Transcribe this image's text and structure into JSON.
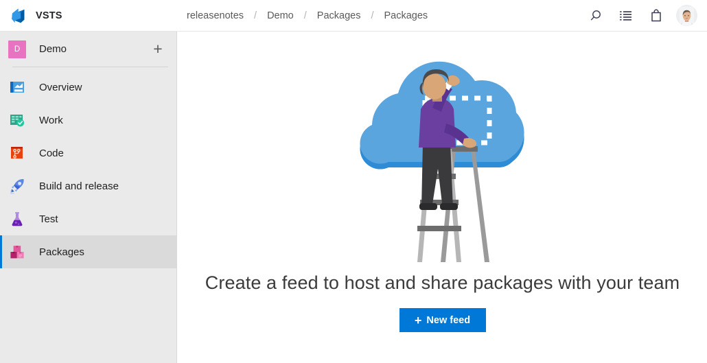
{
  "topbar": {
    "brand": "VSTS",
    "brand_logo_icon": "vsts-logo-icon",
    "breadcrumb": [
      "releasenotes",
      "Demo",
      "Packages",
      "Packages"
    ],
    "breadcrumb_separator": "/",
    "actions": [
      {
        "name": "search-icon",
        "label": "Search"
      },
      {
        "name": "work-items-icon",
        "label": "Work items"
      },
      {
        "name": "marketplace-bag-icon",
        "label": "Marketplace"
      }
    ],
    "avatar_name": "user-avatar"
  },
  "sidebar": {
    "project": {
      "initial": "D",
      "name": "Demo",
      "avatar_color": "#e873c0",
      "add_label": "+"
    },
    "items": [
      {
        "label": "Overview",
        "icon": "overview-icon",
        "selected": false
      },
      {
        "label": "Work",
        "icon": "work-icon",
        "selected": false
      },
      {
        "label": "Code",
        "icon": "code-icon",
        "selected": false
      },
      {
        "label": "Build and release",
        "icon": "build-and-release-icon",
        "selected": false
      },
      {
        "label": "Test",
        "icon": "test-icon",
        "selected": false
      },
      {
        "label": "Packages",
        "icon": "packages-icon",
        "selected": true
      }
    ]
  },
  "main": {
    "illustration_name": "cloud-feed-illustration",
    "title": "Create a feed to host and share packages with your team",
    "cta": {
      "plus": "+",
      "label": "New feed"
    }
  },
  "colors": {
    "accent": "#0078d7",
    "sidebar_bg": "#eaeaea",
    "sidebar_selected_bg": "#dadada",
    "cloud": "#5ba5de",
    "cloud_shadow": "#2e8bd6",
    "shirt": "#6b3fa0",
    "project_avatar": "#e873c0"
  }
}
